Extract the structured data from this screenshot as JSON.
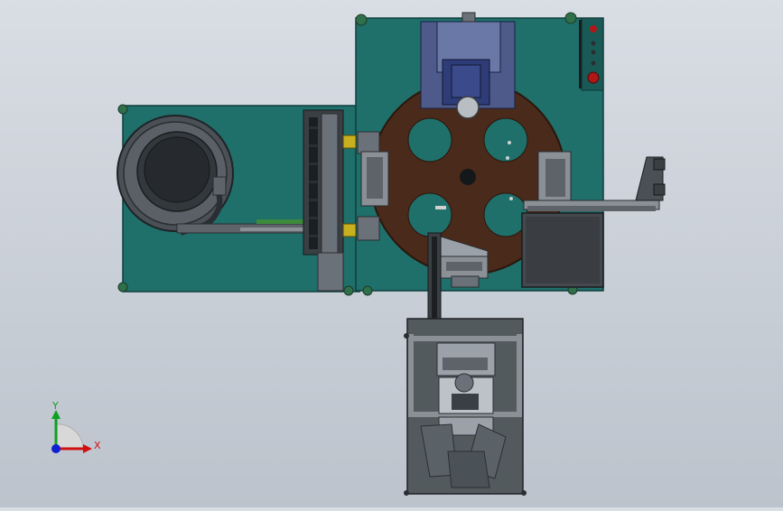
{
  "viewport": {
    "background_top": "#d9dde4",
    "background_bottom": "#bcc3cc"
  },
  "colors": {
    "frame_teal": "#1f6f6a",
    "frame_teal_dark": "#154f4b",
    "disc_brown": "#4a2a1a",
    "steel_dark": "#3a3f44",
    "steel_mid": "#6b7178",
    "steel_light": "#9aa1a8",
    "slide_blue": "#3a4a8a",
    "foot_green": "#2f6f4a",
    "stop_red": "#b01818",
    "sensor_yellow": "#c8b020",
    "axis_x": "#d01010",
    "axis_y": "#10a020",
    "axis_z": "#1020d0"
  },
  "axis_triad": {
    "x_label": "X",
    "y_label": "Y",
    "icon": "coordinate-triad-icon"
  }
}
